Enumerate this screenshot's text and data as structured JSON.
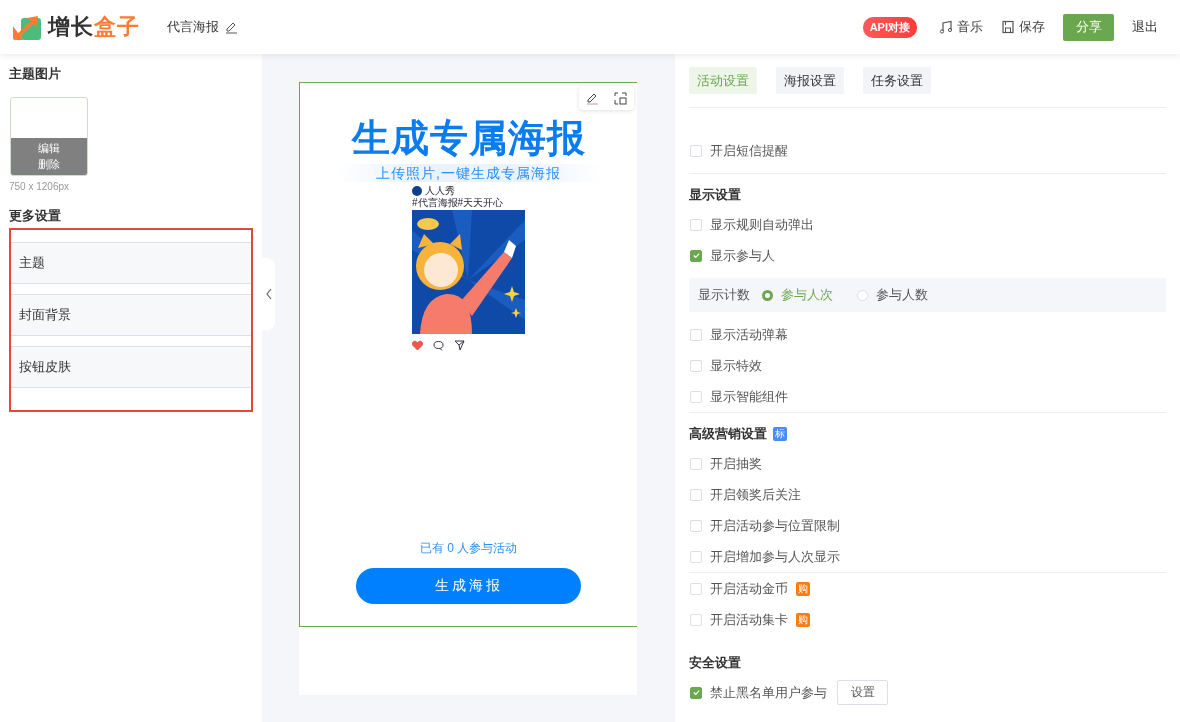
{
  "header": {
    "logo": {
      "part1": "增长",
      "part2": "盒子"
    },
    "doc_title": "代言海报",
    "api_badge": "API对接",
    "actions": [
      {
        "kind": "music",
        "label": "音乐"
      },
      {
        "kind": "save",
        "label": "保存"
      },
      {
        "kind": "primary",
        "label": "分享"
      },
      {
        "kind": "plain",
        "label": "退出"
      }
    ]
  },
  "left_panel": {
    "theme_image": {
      "title": "主题图片",
      "actions": [
        "编辑",
        "删除"
      ],
      "size_hint": "750 x 1206px"
    },
    "more_settings": {
      "title": "更多设置",
      "highlighted": true,
      "items": [
        "主题",
        "封面背景",
        "按钮皮肤"
      ]
    }
  },
  "poster": {
    "title": "生成专属海报",
    "subtitle": "上传照片,一键生成专属海报",
    "account_name": "人人秀",
    "hashtags": "#代言海报#天天开心",
    "liked": true,
    "participants_text": "已有 0 人参与活动",
    "button_label": "生成海报"
  },
  "right_panel": {
    "tabs": [
      {
        "label": "活动设置",
        "selected": true
      },
      {
        "label": "海报设置",
        "selected": false
      },
      {
        "label": "任务设置",
        "selected": false
      }
    ],
    "groups": [
      {
        "divider_below": true,
        "rows": [
          {
            "kind": "checkbox",
            "label": "开启短信提醒",
            "checked": false
          }
        ]
      },
      {
        "title": "显示设置",
        "divider_below": true,
        "rows": [
          {
            "kind": "checkbox",
            "label": "显示规则自动弹出",
            "checked": false
          },
          {
            "kind": "checkbox",
            "label": "显示参与人",
            "checked": true
          },
          {
            "kind": "radio",
            "label": "显示计数",
            "options": [
              {
                "label": "参与人次",
                "selected": true
              },
              {
                "label": "参与人数",
                "selected": false
              }
            ]
          },
          {
            "kind": "checkbox",
            "label": "显示活动弹幕",
            "checked": false
          },
          {
            "kind": "checkbox",
            "label": "显示特效",
            "checked": false
          },
          {
            "kind": "checkbox",
            "label": "显示智能组件",
            "checked": false
          }
        ]
      },
      {
        "title": "高级营销设置",
        "badge": {
          "text": "标",
          "color": "#4a8af4"
        },
        "divider_below": true,
        "rows": [
          {
            "kind": "checkbox",
            "label": "开启抽奖",
            "checked": false
          },
          {
            "kind": "checkbox",
            "label": "开启领奖后关注",
            "checked": false
          },
          {
            "kind": "checkbox",
            "label": "开启活动参与位置限制",
            "checked": false
          },
          {
            "kind": "checkbox",
            "label": "开启增加参与人次显示",
            "checked": false
          }
        ]
      },
      {
        "divider_below": false,
        "rows": [
          {
            "kind": "checkbox",
            "label": "开启活动金币",
            "checked": false,
            "badge": {
              "text": "购",
              "color": "#fa7d14"
            }
          },
          {
            "kind": "checkbox",
            "label": "开启活动集卡",
            "checked": false,
            "badge": {
              "text": "购",
              "color": "#fa7d14"
            }
          }
        ]
      },
      {
        "title": "安全设置",
        "divider_below": false,
        "rows": [
          {
            "kind": "checkbox",
            "label": "禁止黑名单用户参与",
            "checked": true,
            "button": "设置"
          }
        ]
      }
    ]
  }
}
